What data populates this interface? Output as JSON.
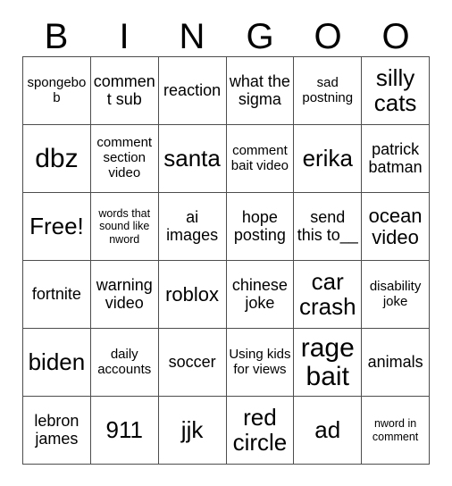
{
  "card": {
    "header_letters": [
      "B",
      "I",
      "N",
      "G",
      "O",
      "O"
    ],
    "columns": 6,
    "rows": 6,
    "border_color": "#4d4d4d",
    "background_color": "#ffffff",
    "text_color": "#000000",
    "cells": [
      [
        {
          "text": "spongebob",
          "size": "s"
        },
        {
          "text": "comment sub",
          "size": "m"
        },
        {
          "text": "reaction",
          "size": "m"
        },
        {
          "text": "what the sigma",
          "size": "m"
        },
        {
          "text": "sad postning",
          "size": "s"
        },
        {
          "text": "silly cats",
          "size": "xl"
        }
      ],
      [
        {
          "text": "dbz",
          "size": "xxl"
        },
        {
          "text": "comment section video",
          "size": "s"
        },
        {
          "text": "santa",
          "size": "xl"
        },
        {
          "text": "comment bait video",
          "size": "s"
        },
        {
          "text": "erika",
          "size": "xl"
        },
        {
          "text": "patrick batman",
          "size": "m"
        }
      ],
      [
        {
          "text": "Free!",
          "size": "xl"
        },
        {
          "text": "words that sound like nword",
          "size": "xs"
        },
        {
          "text": "ai images",
          "size": "m"
        },
        {
          "text": "hope posting",
          "size": "m"
        },
        {
          "text": "send this to__",
          "size": "m"
        },
        {
          "text": "ocean video",
          "size": "l"
        }
      ],
      [
        {
          "text": "fortnite",
          "size": "m"
        },
        {
          "text": "warning video",
          "size": "m"
        },
        {
          "text": "roblox",
          "size": "l"
        },
        {
          "text": "chinese joke",
          "size": "m"
        },
        {
          "text": "car crash",
          "size": "xl"
        },
        {
          "text": "disability joke",
          "size": "s"
        }
      ],
      [
        {
          "text": "biden",
          "size": "xl"
        },
        {
          "text": "daily accounts",
          "size": "s"
        },
        {
          "text": "soccer",
          "size": "m"
        },
        {
          "text": "Using kids for views",
          "size": "s"
        },
        {
          "text": "rage bait",
          "size": "xxl"
        },
        {
          "text": "animals",
          "size": "m"
        }
      ],
      [
        {
          "text": "lebron james",
          "size": "m"
        },
        {
          "text": "911",
          "size": "xl"
        },
        {
          "text": "jjk",
          "size": "xl"
        },
        {
          "text": "red circle",
          "size": "xl"
        },
        {
          "text": "ad",
          "size": "xl"
        },
        {
          "text": "nword in comment",
          "size": "xs"
        }
      ]
    ]
  }
}
